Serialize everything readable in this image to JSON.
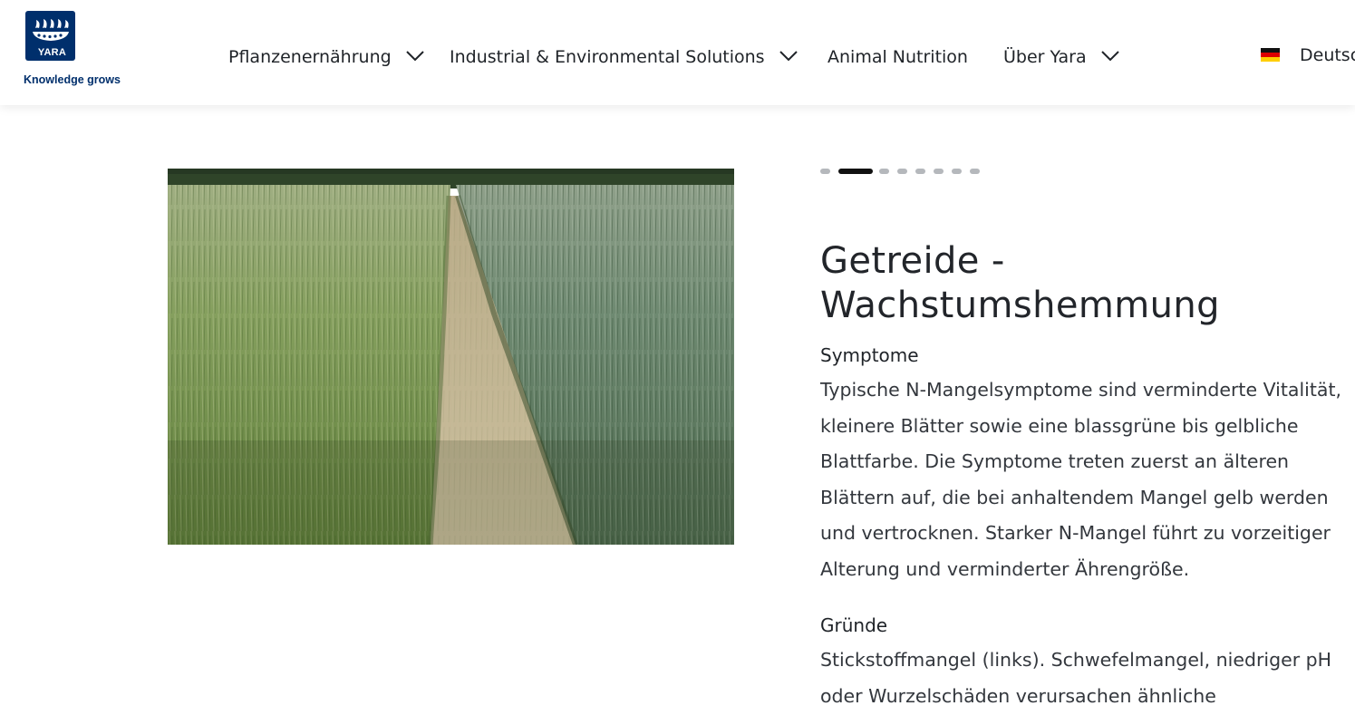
{
  "brand": {
    "logo_word": "YARA",
    "tagline": "Knowledge grows",
    "color": "#002f6c"
  },
  "nav": {
    "items": [
      {
        "label": "Pflanzenernährung",
        "has_dropdown": true
      },
      {
        "label": "Industrial & Environmental Solutions",
        "has_dropdown": true
      },
      {
        "label": "Animal Nutrition",
        "has_dropdown": false
      },
      {
        "label": "Über Yara",
        "has_dropdown": true
      }
    ],
    "language": {
      "label": "Deutsch",
      "flag_icon": "germany-flag-icon"
    }
  },
  "carousel": {
    "slide_count": 9,
    "active_index": 1,
    "image_alt": "wheat-field-photo"
  },
  "content": {
    "title_line1": "Getreide -",
    "title_line2": "Wachstumshemmung",
    "symptoms_heading": "Symptome",
    "symptoms_text": "Typische N-Mangelsymptome sind verminderte Vitalität, kleinere Blätter sowie eine blassgrüne bis gelbliche Blattfarbe. Die Symptome treten zuerst an älteren Blättern auf, die bei anhaltendem Mangel gelb werden und vertrocknen. Starker N-Mangel führt zu vorzeitiger Alterung und verminderter Ährengröße.",
    "causes_heading": "Gründe",
    "causes_text": "Stickstoffmangel (links). Schwefelmangel, niedriger pH oder Wurzelschäden verursachen ähnliche"
  },
  "colors": {
    "text": "#1f2328",
    "dot_active": "#111111",
    "dot_inactive": "#b5b8bc"
  }
}
